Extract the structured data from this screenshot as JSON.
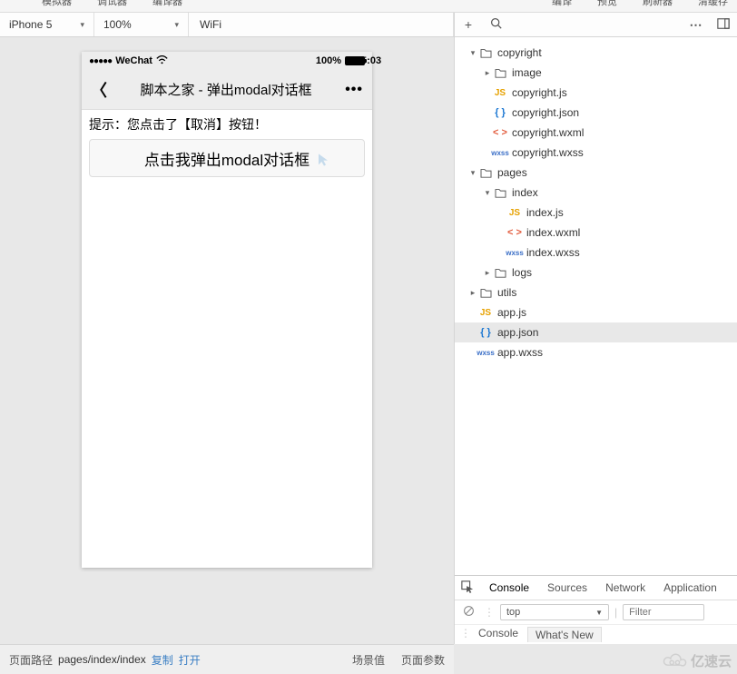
{
  "menubar": [
    "模拟器",
    "调试器",
    "编译器"
  ],
  "menubar_right": [
    "编译",
    "预览",
    "刷新器",
    "清缓存"
  ],
  "toolbar": {
    "device": "iPhone 5",
    "zoom": "100%",
    "network": "WiFi"
  },
  "simulator": {
    "carrier": "WeChat",
    "time": "15:03",
    "battery_pct": "100%",
    "nav_title": "脚本之家 - 弹出modal对话框",
    "hint_text": "提示：您点击了【取消】按钮！",
    "button_label": "点击我弹出modal对话框"
  },
  "tree": [
    {
      "depth": 0,
      "arrow": "▾",
      "icon": "folder",
      "label": "copyright"
    },
    {
      "depth": 1,
      "arrow": "▸",
      "icon": "folder",
      "label": "image"
    },
    {
      "depth": 1,
      "arrow": "",
      "icon": "js",
      "label": "copyright.js"
    },
    {
      "depth": 1,
      "arrow": "",
      "icon": "json",
      "label": "copyright.json"
    },
    {
      "depth": 1,
      "arrow": "",
      "icon": "wxml",
      "label": "copyright.wxml"
    },
    {
      "depth": 1,
      "arrow": "",
      "icon": "wxss",
      "label": "copyright.wxss"
    },
    {
      "depth": 0,
      "arrow": "▾",
      "icon": "folder",
      "label": "pages"
    },
    {
      "depth": 1,
      "arrow": "▾",
      "icon": "folder",
      "label": "index"
    },
    {
      "depth": 2,
      "arrow": "",
      "icon": "js",
      "label": "index.js"
    },
    {
      "depth": 2,
      "arrow": "",
      "icon": "wxml",
      "label": "index.wxml"
    },
    {
      "depth": 2,
      "arrow": "",
      "icon": "wxss",
      "label": "index.wxss"
    },
    {
      "depth": 1,
      "arrow": "▸",
      "icon": "folder",
      "label": "logs"
    },
    {
      "depth": 0,
      "arrow": "▸",
      "icon": "folder",
      "label": "utils"
    },
    {
      "depth": 0,
      "arrow": "",
      "icon": "js",
      "label": "app.js"
    },
    {
      "depth": 0,
      "arrow": "",
      "icon": "json",
      "label": "app.json",
      "selected": true
    },
    {
      "depth": 0,
      "arrow": "",
      "icon": "wxss",
      "label": "app.wxss"
    }
  ],
  "devtools": {
    "tabs": [
      "Console",
      "Sources",
      "Network",
      "Application"
    ],
    "context": "top",
    "filter_placeholder": "Filter"
  },
  "footer": {
    "path_label": "页面路径",
    "path_value": "pages/index/index",
    "copy": "复制",
    "open": "打开",
    "scene": "场景值",
    "params": "页面参数"
  },
  "watermark": "亿速云"
}
